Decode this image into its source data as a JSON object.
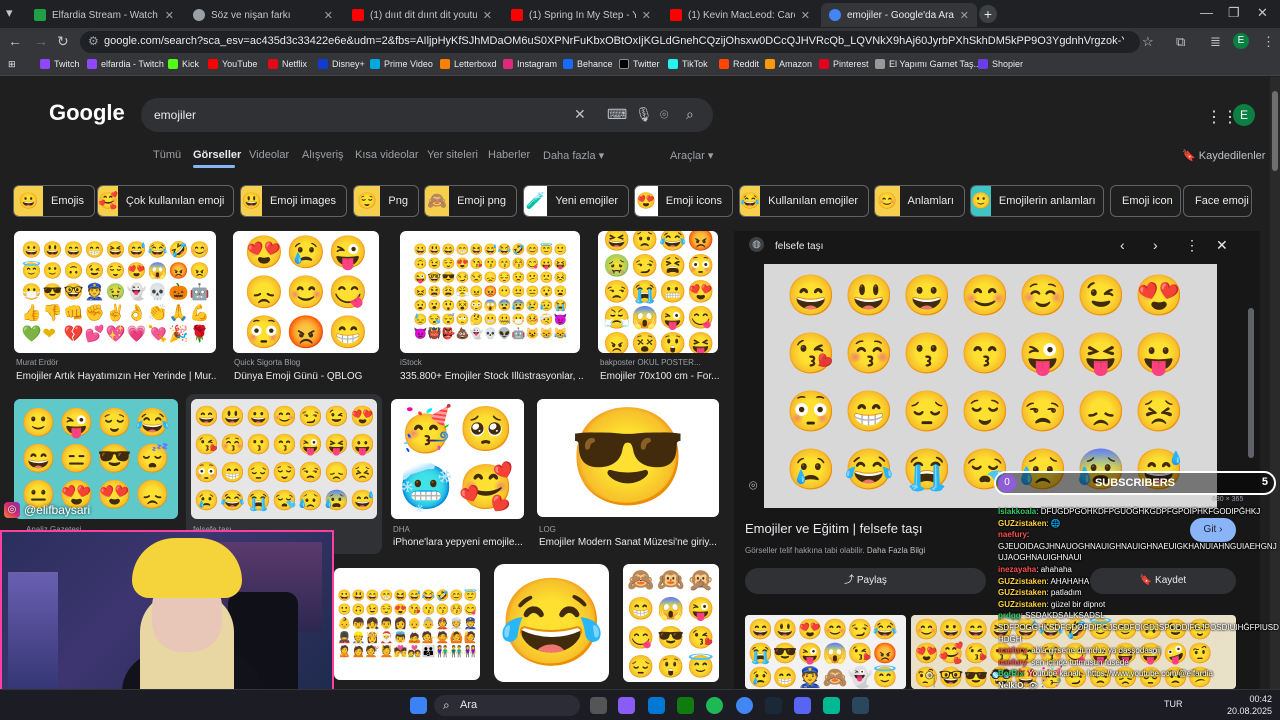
{
  "tabs": [
    {
      "title": "Elfardia Stream - Watch Live o",
      "color": "#1fa046"
    },
    {
      "title": "Söz ve nişan farkı",
      "color": "#9aa0a6"
    },
    {
      "title": "(1) dıııt dit dıınt dit youtuber m",
      "color": "#ff0000"
    },
    {
      "title": "(1) Spring In My Step - YouTub",
      "color": "#ff0000"
    },
    {
      "title": "(1) Kevin MacLeod: Carefree [1",
      "color": "#ff0000"
    },
    {
      "title": "emojiler - Google'da Ara",
      "color": "#4285f4"
    }
  ],
  "url": "google.com/search?sca_esv=ac435d3c33422e6e&udm=2&fbs=AIljpHyKfSJhMDaOM6uS0XPNrFuKbxOBtOxIjKGLdGnehCQzijOhsxw0DCcQJHVRcQb_LQVNkX9hAj60JyrbPXhSkhDM5kPP9O3YgdnhVrgzok-YGob7h4f0WM445zt3POMA7o6RdW2Torzgq71...",
  "bookmarks": [
    "Twitch",
    "elfardia - Twitch",
    "Kick",
    "YouTube",
    "Netflix",
    "Disney+",
    "Prime Video",
    "Letterboxd",
    "Instagram",
    "Behance",
    "Twitter",
    "TikTok",
    "Reddit",
    "Amazon",
    "Pinterest",
    "El Yapımı Garnet Taş...",
    "Shopier"
  ],
  "google": {
    "logo": "Google",
    "query": "emojiler",
    "account_initial": "E",
    "filters": [
      "Tümü",
      "Görseller",
      "Videolar",
      "Alışveriş",
      "Kısa videolar",
      "Yer siteleri",
      "Haberler",
      "Daha fazla ▾",
      "Araçlar ▾"
    ],
    "saved_label": "Kaydedilenler"
  },
  "chips": [
    "Emojis",
    "Çok kullanılan emoji",
    "Emoji images",
    "Png",
    "Emoji png",
    "Yeni emojiler",
    "Emoji icons",
    "Kullanılan emojiler",
    "Anlamları",
    "Emojilerin anlamları",
    "Emoji icon",
    "Face emoji"
  ],
  "results": [
    {
      "source": "Murat Erdör",
      "caption": "Emojiler Artık Hayatımızın Her Yerinde | Mur..."
    },
    {
      "source": "Quick Sigorta Blog",
      "caption": "Dünya Emoji Günü - QBLOG"
    },
    {
      "source": "iStock",
      "caption": "335.800+ Emojiler Stock İllüstrasyonlar, ..."
    },
    {
      "source": "bakposter OKUL POSTER...",
      "caption": "Emojiler 70x100 cm - For..."
    },
    {
      "source": "Analiz Gazetesi",
      "caption": ""
    },
    {
      "source": "felsefe taşı",
      "caption": ""
    },
    {
      "source": "DHA",
      "caption": "iPhone'lara yepyeni emojile..."
    },
    {
      "source": "LOG",
      "caption": "Emojiler Modern Sanat Müzesi'ne giriy..."
    }
  ],
  "panel": {
    "site": "felsefe taşı",
    "dims": "680 × 365",
    "title": "Emojiler ve Eğitim | felsefe taşı",
    "note": "Görseller telif hakkına tabi olabilir.",
    "note_link": "Daha Fazla Bilgi",
    "visit": "Git",
    "share": "Paylaş",
    "save": "Kaydet"
  },
  "overlay": {
    "handle": "@elifbaysari",
    "subs_current": "0",
    "subs_label": "SUBSCRIBERS",
    "subs_goal": "5",
    "subs_progress": 0
  },
  "chat": [
    {
      "user": "Islakkoala",
      "color": "#33cc66",
      "msg": ": DFUGDPGOHKDFPGÜOĞHKGDPFGPOIPHKFGODIPĞHKJ"
    },
    {
      "user": "GUZzistaken",
      "color": "#ffd23f",
      "msg": ": 🌐"
    },
    {
      "user": "naefury",
      "color": "#ff4d4d",
      "msg": ":"
    },
    {
      "user": "",
      "color": "#ffffff",
      "msg": "GJEUOIDAGJHNAUOGHNAUIGHNAUIGHNAEUIGKHANUIAHNGUIAEHGNJUJAOGHNAUIGHNAUI"
    },
    {
      "user": "inezayaha",
      "color": "#ff4d4d",
      "msg": ": ahahaha"
    },
    {
      "user": "GUZzistaken",
      "color": "#ffd23f",
      "msg": ": AHAHAHA"
    },
    {
      "user": "GUZzistaken",
      "color": "#ffd23f",
      "msg": ": patladım"
    },
    {
      "user": "GUZzistaken",
      "color": "#ffd23f",
      "msg": ": güzel bir dipnot"
    },
    {
      "user": "prdgg",
      "color": "#33cc66",
      "msg": ": SSDAKDSALKSADSL"
    },
    {
      "user": "",
      "color": "#ffffff",
      "msg": "SDFPOGĞHKSDFGDOPDIPGJSGDFOIGDJSPODDIFGJPOSDIUIHĞFPIUSDHDGH"
    },
    {
      "user": "naefury",
      "color": "#ff4d4d",
      "msg": ": abla girsene dumduz ya daşşodasoij"
    },
    {
      "user": "naefury",
      "color": "#ff4d4d",
      "msg": ": sen içinde tutmuşun fusede"
    },
    {
      "user": "BotRix",
      "color": "#33cc66",
      "msg": ": Youtube kanalı : https://www.youtube.com/@elfardia"
    },
    {
      "user": "NelkiO",
      "color": "#ffffff",
      "msg": ": 👁"
    }
  ],
  "taskbar": {
    "search": "Ara",
    "lang": "TUR",
    "time": "00:42",
    "date": "20.08.2025"
  }
}
